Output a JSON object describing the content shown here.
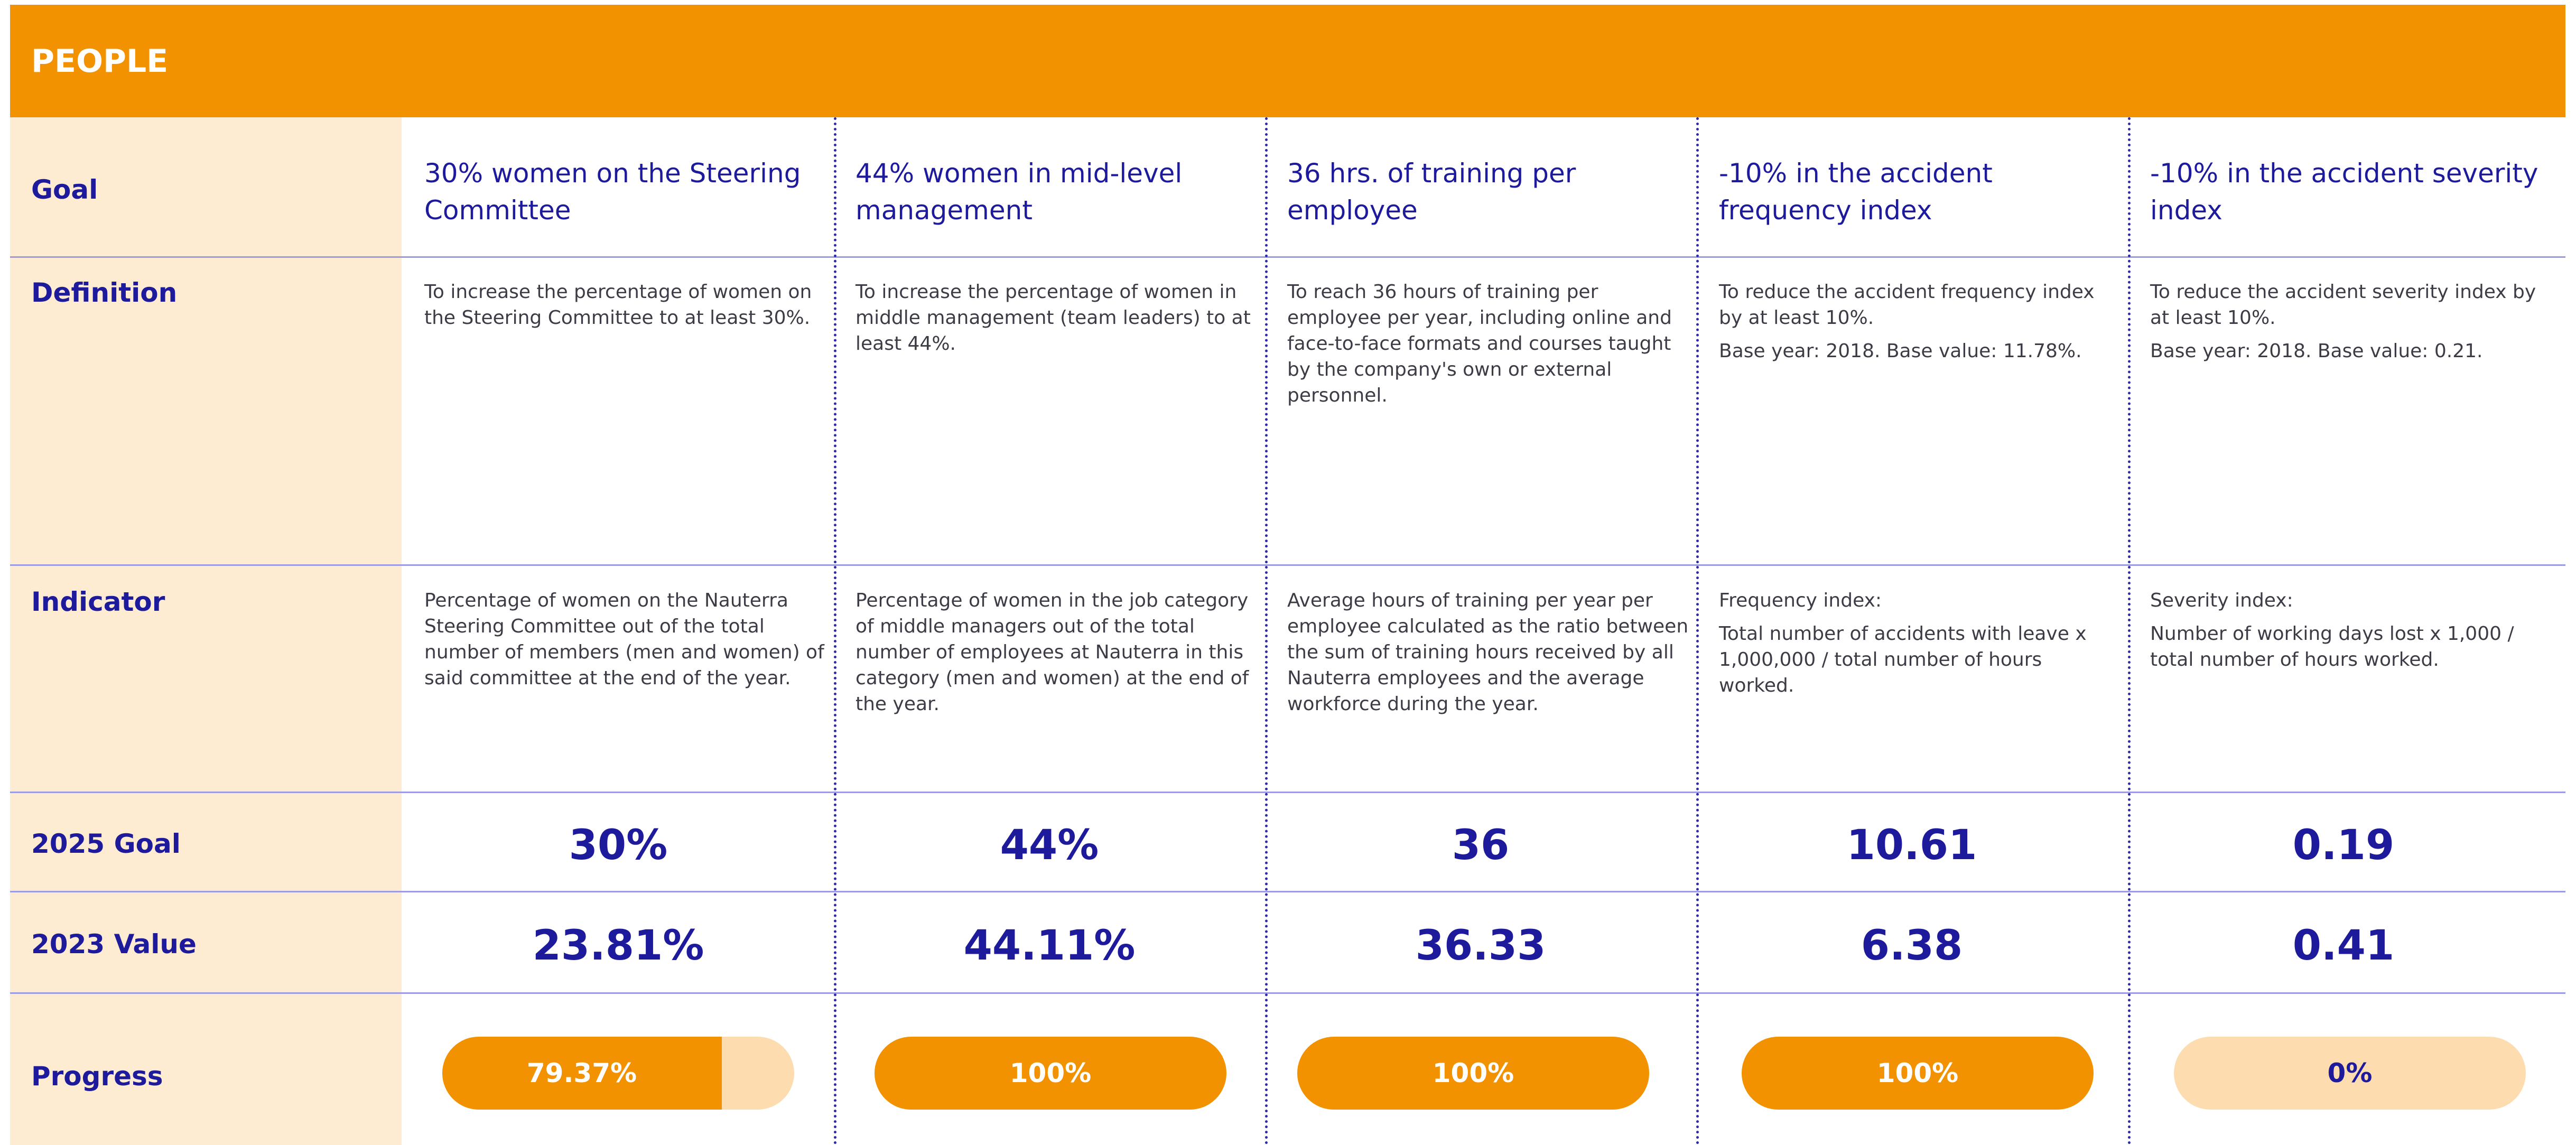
{
  "section_title": "PEOPLE",
  "row_labels": {
    "goal": "Goal",
    "definition": "Definition",
    "indicator": "Indicator",
    "goal_2025": "2025 Goal",
    "value_2023": "2023 Value",
    "progress": "Progress"
  },
  "colors": {
    "header": "#f29200",
    "label_column": "#fdebd2",
    "text_primary": "#1e1a9c",
    "progress_fill": "#f29200",
    "progress_track": "#fddcaf"
  },
  "columns": [
    {
      "goal": "30% women on the Steering Committee",
      "definition": [
        "To increase the percentage of women on the Steering Committee to at least 30%."
      ],
      "indicator": [
        "Percentage of women on the Nauterra Steering Committee out of the total number of members (men and women) of said committee at the end of the year."
      ],
      "goal_2025": "30%",
      "value_2023": "23.81%",
      "progress_label": "79.37%",
      "progress_fraction": 0.7937
    },
    {
      "goal": "44% women in mid-level management",
      "definition": [
        "To increase the percentage of women in middle management (team leaders) to at least 44%."
      ],
      "indicator": [
        "Percentage of women in the job category of middle managers out of the total number of employees at Nauterra in this category (men and women) at the end of the year."
      ],
      "goal_2025": "44%",
      "value_2023": "44.11%",
      "progress_label": "100%",
      "progress_fraction": 1.0
    },
    {
      "goal": "36 hrs. of training per employee",
      "definition": [
        "To reach 36 hours of training per employee per year, including online and face-to-face formats and courses taught by the company's own or external personnel."
      ],
      "indicator": [
        "Average hours of training per year per employee calculated as the ratio between the sum of training hours received by all Nauterra employees and the average workforce during the year."
      ],
      "goal_2025": "36",
      "value_2023": "36.33",
      "progress_label": "100%",
      "progress_fraction": 1.0
    },
    {
      "goal": "-10% in the accident frequency index",
      "definition": [
        "To reduce the accident frequency index by at least 10%.",
        "Base year: 2018. Base value: 11.78%."
      ],
      "indicator": [
        "Frequency index:",
        "Total number of accidents with leave x 1,000,000 / total number of hours worked."
      ],
      "goal_2025": "10.61",
      "value_2023": "6.38",
      "progress_label": "100%",
      "progress_fraction": 1.0
    },
    {
      "goal": "-10% in the accident severity index",
      "definition": [
        "To reduce the accident severity index by at least 10%.",
        "Base year: 2018. Base value: 0.21."
      ],
      "indicator": [
        "Severity index:",
        "Number of working days lost x 1,000 / total number of hours worked."
      ],
      "goal_2025": "0.19",
      "value_2023": "0.41",
      "progress_label": "0%",
      "progress_fraction": 0.0
    }
  ]
}
